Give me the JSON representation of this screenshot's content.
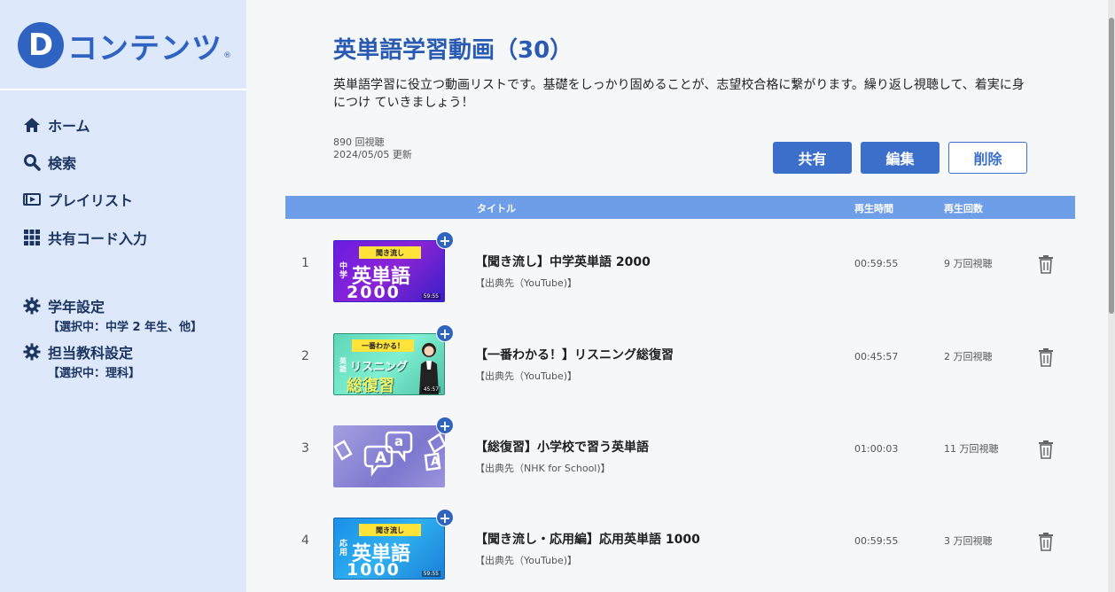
{
  "brand": {
    "mark": "D",
    "name": "コンテンツ",
    "reg": "®"
  },
  "sidebar": {
    "nav": [
      {
        "label": "ホーム",
        "icon": "home-icon"
      },
      {
        "label": "検索",
        "icon": "search-icon"
      },
      {
        "label": "プレイリスト",
        "icon": "playlist-icon"
      },
      {
        "label": "共有コード入力",
        "icon": "grid-icon"
      }
    ],
    "settings": [
      {
        "label": "学年設定",
        "sub": "【選択中：中学 2 年生、他】",
        "icon": "gear-icon"
      },
      {
        "label": "担当教科設定",
        "sub": "【選択中：理科】",
        "icon": "gear-icon"
      }
    ]
  },
  "page": {
    "title": "英単語学習動画（30）",
    "description": "英単語学習に役立つ動画リストです。基礎をしっかり固めることが、志望校合格に繋がります。繰り返し視聴して、着実に身につけ ていきましょう！",
    "views": "890 回視聴",
    "updated": "2024/05/05 更新",
    "buttons": {
      "share": "共有",
      "edit": "編集",
      "delete": "削除"
    }
  },
  "table": {
    "headers": {
      "title": "タイトル",
      "duration": "再生時間",
      "views": "再生回数"
    },
    "rows": [
      {
        "num": "1",
        "title": "【聞き流し】中学英単語 2000",
        "source": "【出典先（YouTube)】",
        "duration": "00:59:55",
        "views": "9 万回視聴",
        "thumb": {
          "banner": "聞き流し",
          "side": "中学",
          "main": "英単語",
          "big": "2000",
          "dur": "59:55"
        }
      },
      {
        "num": "2",
        "title": "【一番わかる！】リスニング総復習",
        "source": "【出典先（YouTube)】",
        "duration": "00:45:57",
        "views": "2 万回視聴",
        "thumb": {
          "banner": "一番わかる！",
          "side": "英語",
          "main": "リスニング",
          "big": "総復習",
          "dur": "45:57"
        }
      },
      {
        "num": "3",
        "title": "【総復習】小学校で習う英単語",
        "source": "【出典先（NHK for School)】",
        "duration": "01:00:03",
        "views": "11 万回視聴",
        "thumb": {
          "a1": "a",
          "a2": "A",
          "a3": "A"
        }
      },
      {
        "num": "4",
        "title": "【聞き流し・応用編】応用英単語 1000",
        "source": "【出典先（YouTube)】",
        "duration": "00:59:55",
        "views": "3 万回視聴",
        "thumb": {
          "banner": "聞き流し",
          "side": "応用",
          "main": "英単語",
          "big": "1000",
          "dur": "59:55"
        }
      }
    ]
  },
  "colors": {
    "accent": "#2f63c2",
    "sidebar": "#dde8fa",
    "header": "#6f9ee9"
  }
}
